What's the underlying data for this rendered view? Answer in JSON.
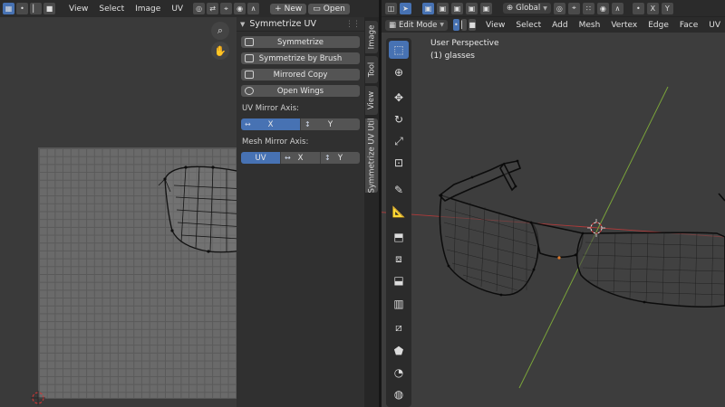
{
  "uv_editor": {
    "menus": [
      "View",
      "Select",
      "Image",
      "UV"
    ],
    "new_label": "New",
    "open_label": "Open"
  },
  "n_panel": {
    "title": "Symmetrize UV",
    "buttons": [
      {
        "label": "Symmetrize",
        "icon": "symmetrize-icon"
      },
      {
        "label": "Symmetrize by Brush",
        "icon": "brush-icon"
      },
      {
        "label": "Mirrored Copy",
        "icon": "mirror-copy-icon"
      },
      {
        "label": "Open Wings",
        "icon": "open-wings-icon"
      }
    ],
    "uv_mirror_axis": {
      "label": "UV Mirror Axis:",
      "options": [
        {
          "label": "X",
          "selected": true
        },
        {
          "label": "Y",
          "selected": false
        }
      ]
    },
    "mesh_mirror_axis": {
      "label": "Mesh Mirror Axis:",
      "options": [
        {
          "label": "UV",
          "selected": true
        },
        {
          "label": "X",
          "selected": false
        },
        {
          "label": "Y",
          "selected": false
        }
      ]
    },
    "tabs": [
      {
        "label": "Image",
        "active": false
      },
      {
        "label": "Tool",
        "active": false
      },
      {
        "label": "View",
        "active": false
      },
      {
        "label": "Symmetrize UV Util",
        "active": true
      }
    ]
  },
  "viewport": {
    "transform_orientation": "Global",
    "mode": "Edit Mode",
    "menus": [
      "View",
      "Select",
      "Add",
      "Mesh",
      "Vertex",
      "Edge",
      "Face",
      "UV"
    ],
    "axis_labels": [
      "X",
      "Y"
    ],
    "perspective_label": "User Perspective",
    "object_label": "(1) glasses",
    "tools": [
      "select-box-icon",
      "cursor-icon",
      "move-icon",
      "rotate-icon",
      "scale-icon",
      "transform-icon",
      "annotate-icon",
      "measure-icon",
      "extrude-icon",
      "inset-icon",
      "bevel-icon",
      "loop-cut-icon",
      "knife-icon",
      "poly-build-icon",
      "spin-icon",
      "smooth-icon"
    ]
  },
  "colors": {
    "accent": "#4772b3",
    "panel_bg": "#303030",
    "uv_grid": "#6a6a6a"
  }
}
